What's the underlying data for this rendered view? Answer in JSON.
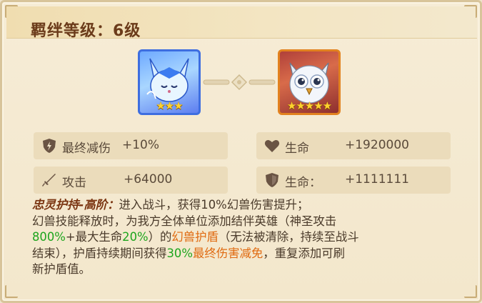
{
  "title": "羁绊等级：6级",
  "heroes": [
    {
      "name": "fox-beast",
      "stars": 3,
      "frame_color": "#3e6ee0"
    },
    {
      "name": "owl-beast",
      "stars": 5,
      "frame_color": "#e2821f"
    }
  ],
  "stats": {
    "left": [
      {
        "icon": "shield-lightning-icon",
        "label": "最终减伤",
        "value": "+10%"
      },
      {
        "icon": "sword-icon",
        "label": "攻击",
        "value": "+64000"
      }
    ],
    "right": [
      {
        "icon": "heart-icon",
        "label": "生命",
        "value": "+1920000"
      },
      {
        "icon": "shield-icon",
        "label": "生命：",
        "value": "+1111111"
      }
    ]
  },
  "description": {
    "skill_name": "忠灵护持-高阶：",
    "p1": "进入战斗，获得10%幻兽伤害提升；",
    "p2": "幻兽技能释放时，为我方全体单位添加结伴英雄（神圣攻击",
    "p3_green1": "800%",
    "p3_a": "+最大生命",
    "p3_green2": "20%",
    "p3_b": "）的",
    "p3_orange": "幻兽护盾",
    "p3_c": "（无法被清除，持续至战斗",
    "p4_a": "结束），护盾持续期间获得",
    "p4_green": "30%",
    "p4_orange": "最终伤害减免",
    "p4_b": "，重复添加可刷",
    "p5": "新护盾值。"
  },
  "colors": {
    "title": "#6b3b1a",
    "highlight_green": "#1ea51e",
    "highlight_orange": "#e06a10",
    "stat_box": "#ebdcbb"
  }
}
